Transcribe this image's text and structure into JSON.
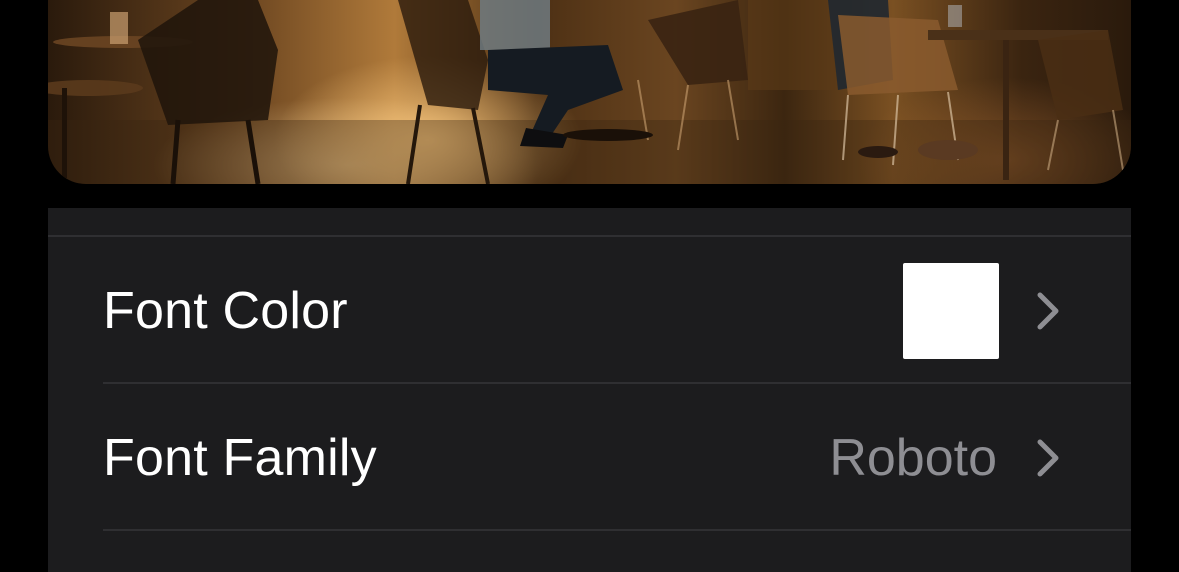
{
  "header_image": {
    "description_icon": "restaurant-photo"
  },
  "settings": {
    "rows": [
      {
        "label": "Font Color",
        "swatch_color": "#ffffff",
        "chevron_icon": "chevron-right-icon"
      },
      {
        "label": "Font Family",
        "value": "Roboto",
        "chevron_icon": "chevron-right-icon"
      }
    ]
  },
  "colors": {
    "background": "#000000",
    "group_background": "#1c1c1e",
    "separator": "#2f2f32",
    "label_text": "#ffffff",
    "secondary_text": "#8e8e93",
    "chevron": "#8e8e93"
  }
}
